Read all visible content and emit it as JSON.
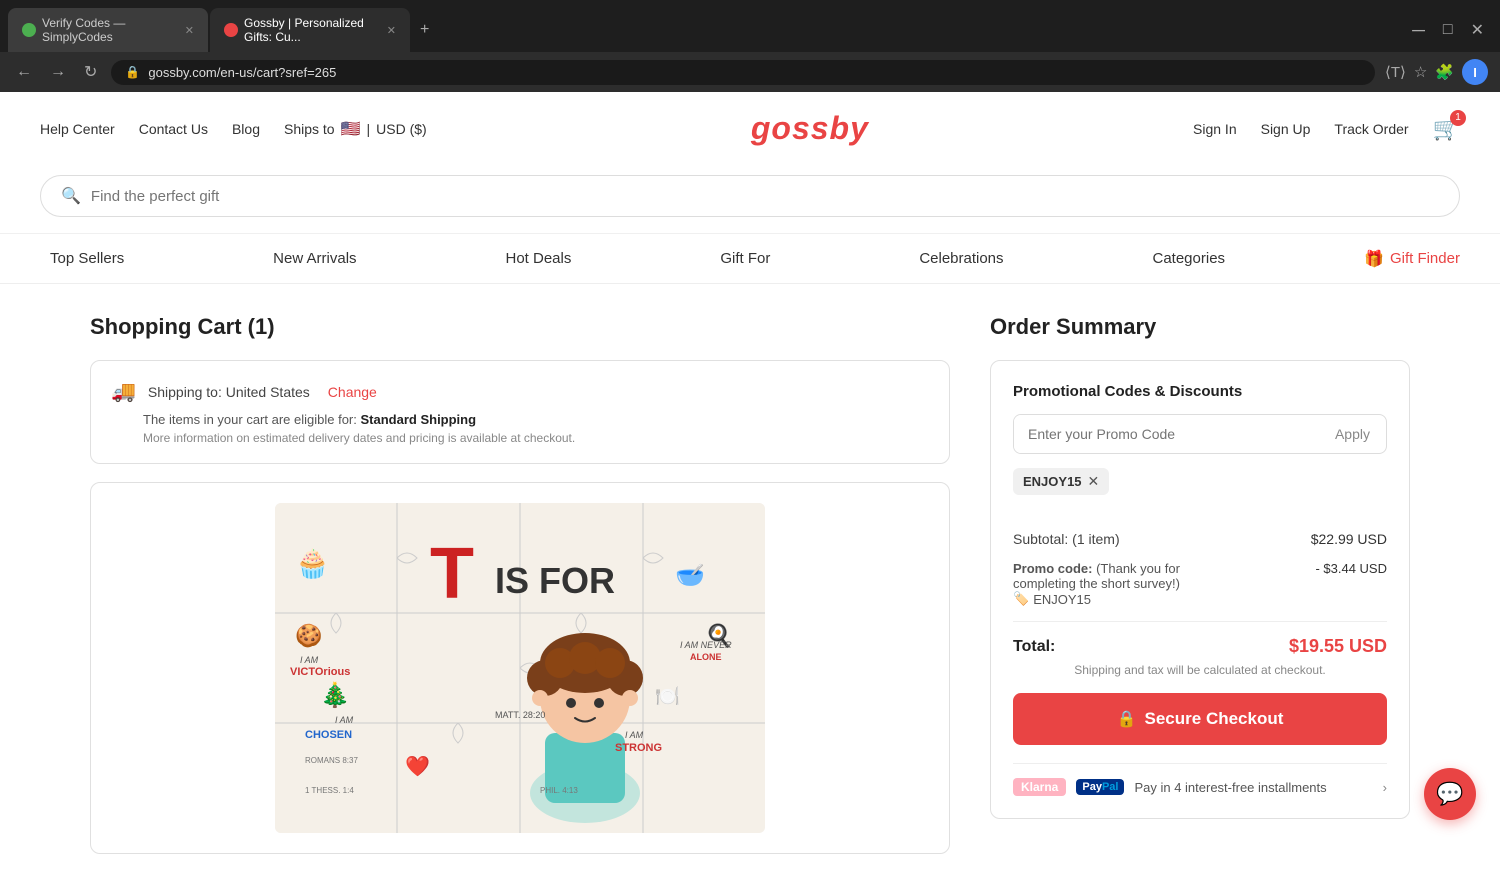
{
  "browser": {
    "tabs": [
      {
        "id": "tab1",
        "label": "Verify Codes — SimplyCodes",
        "favicon_type": "green",
        "active": false
      },
      {
        "id": "tab2",
        "label": "Gossby | Personalized Gifts: Cu...",
        "favicon_type": "gossby",
        "active": true
      }
    ],
    "url": "gossby.com/en-us/cart?sref=265",
    "add_tab_label": "+"
  },
  "header": {
    "nav_left": [
      {
        "id": "help-center",
        "label": "Help Center"
      },
      {
        "id": "contact-us",
        "label": "Contact Us"
      },
      {
        "id": "blog",
        "label": "Blog"
      }
    ],
    "ships_to": "Ships to",
    "currency": "USD ($)",
    "logo": "gossby",
    "nav_right": [
      {
        "id": "sign-in",
        "label": "Sign In"
      },
      {
        "id": "sign-up",
        "label": "Sign Up"
      },
      {
        "id": "track-order",
        "label": "Track Order"
      }
    ],
    "cart_count": "1"
  },
  "search": {
    "placeholder": "Find the perfect gift"
  },
  "main_nav": [
    {
      "id": "top-sellers",
      "label": "Top Sellers"
    },
    {
      "id": "new-arrivals",
      "label": "New Arrivals"
    },
    {
      "id": "hot-deals",
      "label": "Hot Deals"
    },
    {
      "id": "gift-for",
      "label": "Gift For"
    },
    {
      "id": "celebrations",
      "label": "Celebrations"
    },
    {
      "id": "categories",
      "label": "Categories"
    },
    {
      "id": "gift-finder",
      "label": "Gift Finder"
    }
  ],
  "cart": {
    "title": "Shopping Cart (1)",
    "shipping": {
      "label": "Shipping to: United States",
      "change_link": "Change",
      "eligible_text": "The items in your cart are eligible for:",
      "eligible_type": "Standard Shipping",
      "delivery_note": "More information on estimated delivery dates and pricing is available at checkout."
    }
  },
  "order_summary": {
    "title": "Order Summary",
    "promo_section_title": "Promotional Codes & Discounts",
    "promo_input_placeholder": "Enter your Promo Code",
    "apply_btn_label": "Apply",
    "applied_code": "ENJOY15",
    "subtotal_label": "Subtotal: (1 item)",
    "subtotal_value": "$22.99 USD",
    "promo_label": "Promo code:",
    "promo_note": "(Thank you for completing the short survey!)",
    "promo_discount": "- $3.44 USD",
    "promo_badge": "ENJOY15",
    "total_label": "Total:",
    "total_value": "$19.55 USD",
    "shipping_note": "Shipping and tax will be calculated at checkout.",
    "checkout_btn_label": "Secure Checkout",
    "klarna_label": "Klarna",
    "paypal_label": "PayPal",
    "installment_text": "Pay in 4 interest-free installments"
  }
}
